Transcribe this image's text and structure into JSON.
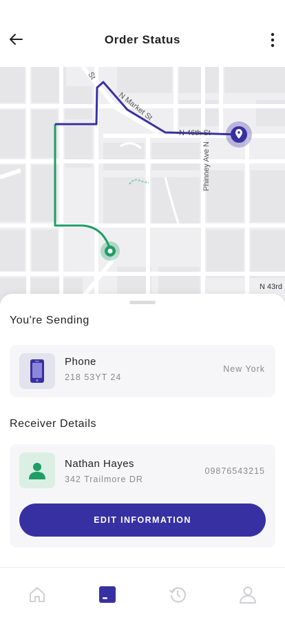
{
  "header": {
    "title": "Order Status",
    "back_icon": "arrow-left-icon",
    "menu_icon": "more-vertical-icon"
  },
  "map": {
    "streets": [
      "St",
      "N Market St",
      "N 46th St",
      "Phinney Ave N",
      "N 43rd"
    ],
    "colors": {
      "route_blue": "#3730a3",
      "route_green": "#1f9d66"
    }
  },
  "sending": {
    "title": "You're Sending",
    "item_name": "Phone",
    "item_code": "218 53YT 24",
    "location": "New York",
    "icon": "phone-icon"
  },
  "receiver": {
    "title": "Receiver Details",
    "name": "Nathan Hayes",
    "address": "342 Trailmore DR",
    "phone": "09876543215",
    "icon": "user-icon",
    "edit_label": "EDIT INFORMATION"
  },
  "nav": {
    "items": [
      "home-icon",
      "package-icon",
      "history-icon",
      "profile-icon"
    ],
    "active": "package-icon",
    "colors": {
      "active": "#3730a3",
      "inactive": "#cfcfd4"
    }
  }
}
